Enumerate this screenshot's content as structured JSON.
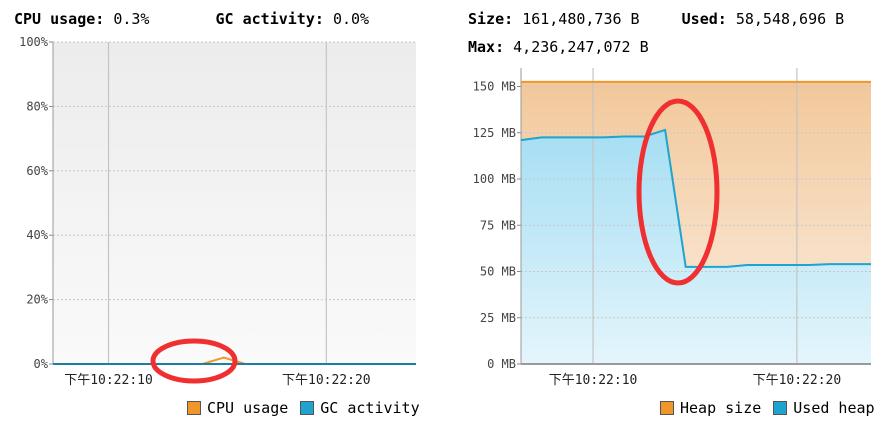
{
  "left": {
    "cpu_label": "CPU usage:",
    "cpu_value": "0.3%",
    "gc_label": "GC activity:",
    "gc_value": "0.0%",
    "legend": [
      {
        "label": "CPU usage",
        "color": "#f0962a"
      },
      {
        "label": "GC activity",
        "color": "#1fa3cf"
      }
    ]
  },
  "right": {
    "size_label": "Size:",
    "size_value": "161,480,736 B",
    "used_label": "Used:",
    "used_value": "58,548,696 B",
    "max_label": "Max:",
    "max_value": "4,236,247,072 B",
    "legend": [
      {
        "label": "Heap size",
        "color": "#f0962a"
      },
      {
        "label": "Used heap",
        "color": "#1fa3cf"
      }
    ]
  },
  "chart_data": [
    {
      "type": "line",
      "x_tick_labels": [
        "下午10:22:10",
        "下午10:22:20"
      ],
      "y_tick_labels": [
        "0%",
        "20%",
        "40%",
        "60%",
        "80%",
        "100%"
      ],
      "ylim": [
        0,
        100
      ],
      "grid": true,
      "legend_placement": "bottom-right",
      "series": [
        {
          "name": "CPU usage",
          "color": "#f0962a",
          "t": [
            0,
            1,
            2,
            3,
            4,
            5,
            6,
            7,
            8,
            9,
            10,
            11,
            12,
            13,
            14,
            15,
            16,
            17
          ],
          "values": [
            0,
            0,
            0,
            0,
            0,
            0,
            0,
            0,
            2,
            0,
            0,
            0,
            0,
            0,
            0,
            0,
            0,
            0
          ]
        },
        {
          "name": "GC activity",
          "color": "#1fa3cf",
          "t": [
            0,
            17
          ],
          "values": [
            0,
            0
          ]
        }
      ],
      "annotations": [
        {
          "shape": "ellipse",
          "color": "#f03030",
          "around": "CPU usage spike"
        }
      ]
    },
    {
      "type": "area",
      "x_tick_labels": [
        "下午10:22:10",
        "下午10:22:20"
      ],
      "y_tick_labels": [
        "0 MB",
        "25 MB",
        "50 MB",
        "75 MB",
        "100 MB",
        "125 MB",
        "150 MB"
      ],
      "ylim": [
        0,
        160
      ],
      "grid": true,
      "legend_placement": "bottom-right",
      "series": [
        {
          "name": "Heap size",
          "color": "#f0962a",
          "t": [
            0,
            17
          ],
          "values": [
            152.5,
            152.5
          ]
        },
        {
          "name": "Used heap",
          "color": "#1fa3cf",
          "t": [
            0,
            1,
            2,
            4,
            5,
            6,
            7,
            8,
            9,
            10,
            11,
            12,
            13,
            14,
            15,
            16,
            17
          ],
          "values": [
            121,
            122.5,
            122.5,
            122.5,
            123,
            123,
            126.5,
            52.5,
            52.5,
            52.5,
            53.5,
            53.5,
            53.5,
            53.5,
            54,
            54,
            54
          ]
        }
      ],
      "annotations": [
        {
          "shape": "ellipse",
          "color": "#f03030",
          "around": "Used heap drop"
        }
      ]
    }
  ]
}
